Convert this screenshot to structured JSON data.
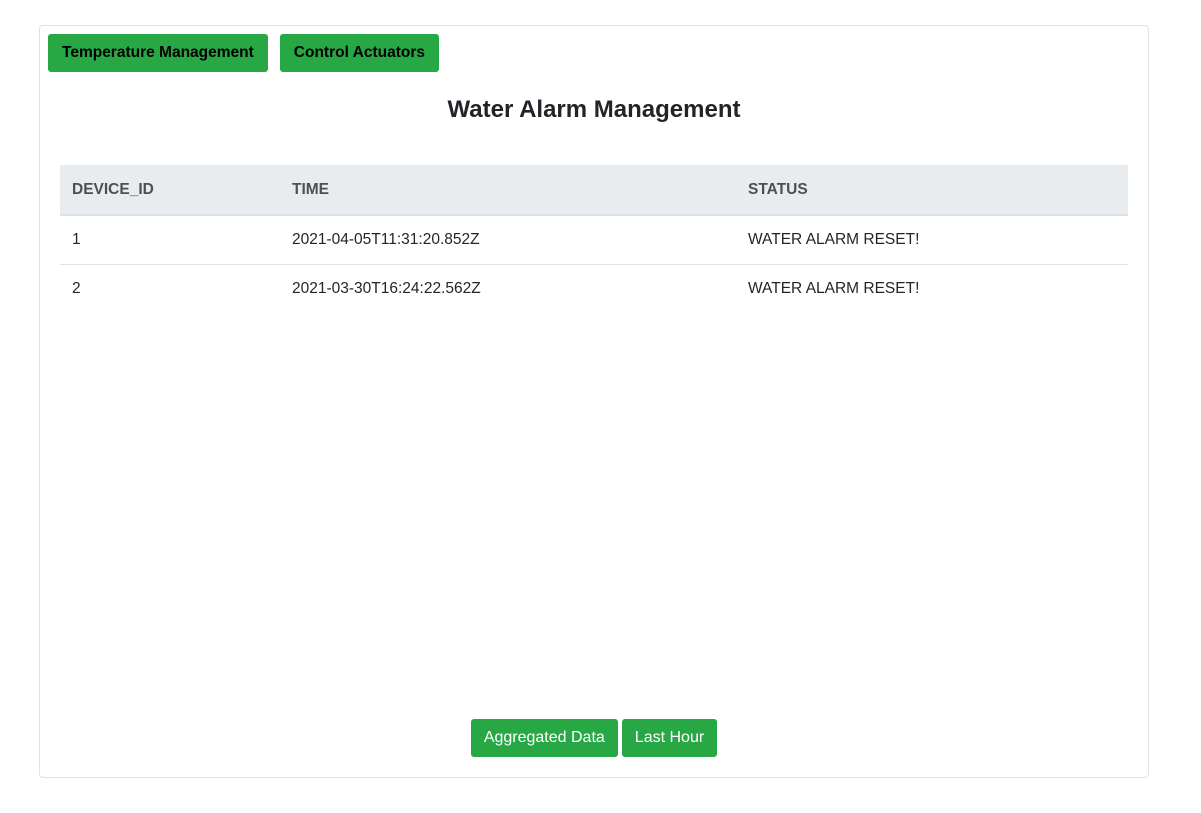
{
  "nav": {
    "temperature_label": "Temperature Management",
    "actuators_label": "Control Actuators"
  },
  "page": {
    "title": "Water Alarm Management"
  },
  "table": {
    "headers": [
      "DEVICE_ID",
      "TIME",
      "STATUS"
    ],
    "rows": [
      [
        "1",
        "2021-04-05T11:31:20.852Z",
        "WATER ALARM RESET!"
      ],
      [
        "2",
        "2021-03-30T16:24:22.562Z",
        "WATER ALARM RESET!"
      ]
    ]
  },
  "actions": {
    "aggregated_label": "Aggregated Data",
    "last_hour_label": "Last Hour"
  },
  "colors": {
    "button_green": "#28a745",
    "table_header_bg": "#e9ecef"
  }
}
